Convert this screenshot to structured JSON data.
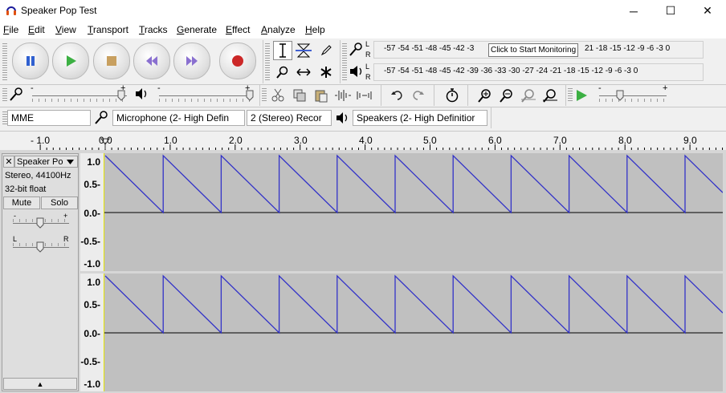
{
  "window": {
    "title": "Speaker Pop Test",
    "minimize": "─",
    "maximize": "☐",
    "close": "✕"
  },
  "menu": [
    {
      "label": "File",
      "u": "F",
      "rest": "ile"
    },
    {
      "label": "Edit",
      "u": "E",
      "rest": "dit"
    },
    {
      "label": "View",
      "u": "V",
      "rest": "iew"
    },
    {
      "label": "Transport",
      "u": "T",
      "rest": "ransport"
    },
    {
      "label": "Tracks",
      "u": "T",
      "rest": "racks"
    },
    {
      "label": "Generate",
      "u": "G",
      "rest": "enerate"
    },
    {
      "label": "Effect",
      "u": "E",
      "rest": "ffect"
    },
    {
      "label": "Analyze",
      "u": "A",
      "rest": "nalyze"
    },
    {
      "label": "Help",
      "u": "H",
      "rest": "elp"
    }
  ],
  "meters": {
    "record_scale": "-57 -54 -51 -48 -45 -42 -3",
    "record_tooltip": "Click to Start Monitoring",
    "record_scale_tail": "21 -18 -15 -12 -9 -6 -3 0",
    "playback_scale": "-57 -54 -51 -48 -45 -42 -39 -36 -33 -30 -27 -24 -21 -18 -15 -12 -9 -6 -3 0",
    "lr_left": "L",
    "lr_right": "R"
  },
  "sliders": {
    "minus": "-",
    "plus": "+"
  },
  "devices": {
    "host": "MME",
    "input": "Microphone (2- High Defin",
    "channels": "2 (Stereo) Recor",
    "output": "Speakers (2- High Definitior"
  },
  "ruler": [
    "- 1.0",
    "0.0",
    "1.0",
    "2.0",
    "3.0",
    "4.0",
    "5.0",
    "6.0",
    "7.0",
    "8.0",
    "9.0"
  ],
  "track": {
    "name": "Speaker Po",
    "close": "✕",
    "format": "Stereo, 44100Hz",
    "bitdepth": "32-bit float",
    "mute": "Mute",
    "solo": "Solo",
    "gain_minus": "-",
    "gain_plus": "+",
    "pan_left": "L",
    "pan_right": "R",
    "collapse": "▲"
  },
  "vscale": [
    "1.0",
    "0.5-",
    "0.0-",
    "-0.5-",
    "-1.0"
  ],
  "colors": {
    "waveform": "#3232c8",
    "wave_bg": "#c0c0c0",
    "play_green": "#3cb043",
    "record_red": "#cc2828",
    "pause_blue": "#3060d0",
    "skip_purple": "#7050c0"
  }
}
